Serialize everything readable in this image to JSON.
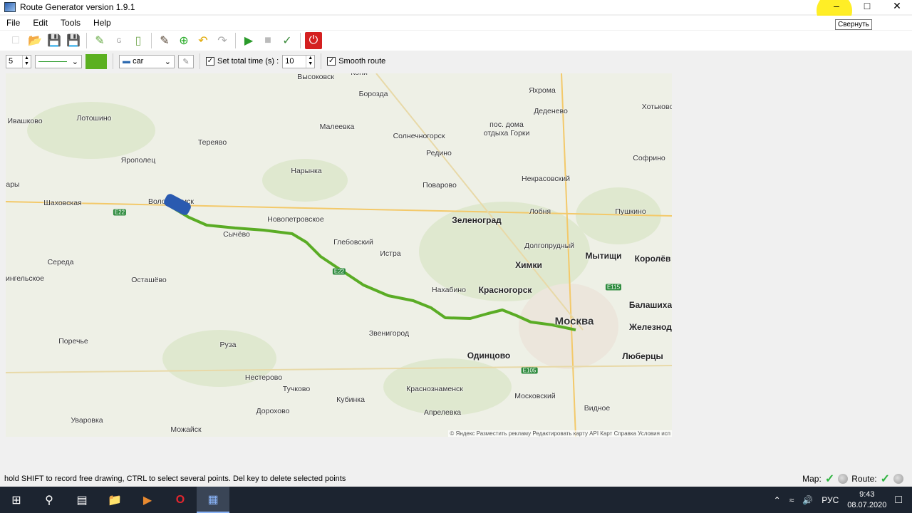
{
  "window": {
    "title": "Route Generator version 1.9.1",
    "minimize_tooltip": "Свернуть"
  },
  "menu": [
    "File",
    "Edit",
    "Tools",
    "Help"
  ],
  "toolbar": [
    "new-file",
    "open-folder",
    "save",
    "save-as",
    "edit-route",
    "import-google",
    "gps-device",
    "draw-brush",
    "add-point",
    "undo",
    "redo",
    "play",
    "stop",
    "export-route",
    "exit-power"
  ],
  "options": {
    "line_width": "5",
    "line_color": "#5bb020",
    "vehicle": "car",
    "set_total_time_label": "Set total time (s) :",
    "set_total_time_checked": true,
    "total_time": "10",
    "smooth_route_label": "Smooth route",
    "smooth_route_checked": true
  },
  "map": {
    "route_color": "#5aac25",
    "labels": [
      "Высоковск",
      "Борозда",
      "Яхрома",
      "Деденево",
      "Хотьково",
      "Ивашково",
      "Лотошино",
      "Малеевка",
      "Солнечногорск",
      "пос. дома",
      "отдыха Горки",
      "Тереяво",
      "Редино",
      "Софрино",
      "Ярополец",
      "Нарынка",
      "Некрасовский",
      "Поварово",
      "Шаховская",
      "Волоколамск",
      "Лобня",
      "Пушкино",
      "Зеленоград",
      "Новопетровское",
      "Сычёво",
      "Глебовский",
      "Долгопрудный",
      "Истра",
      "Мытищи",
      "Королёв",
      "Середа",
      "Химки",
      "ингельское",
      "Осташёво",
      "Нахабино",
      "Красногорск",
      "Балашиха",
      "Москва",
      "Железнод",
      "Звенигород",
      "Поречье",
      "Руза",
      "Одинцово",
      "Люберцы",
      "Нестерово",
      "Тучково",
      "Краснознаменск",
      "Московский",
      "Кубинка",
      "Дорохово",
      "Видное",
      "Апрелевка",
      "Уваровка",
      "Можайск",
      "ары",
      "Кони"
    ],
    "roads": [
      "E22",
      "E22",
      "E115",
      "E105"
    ],
    "copyright": "© Яндекс  Разместить рекламу  Редактировать карту  API Карт  Справка  Условия исп"
  },
  "status": {
    "hint": "hold SHIFT to record free drawing, CTRL to select several points. Del key to delete selected points",
    "map_label": "Map:",
    "route_label": "Route:"
  },
  "taskbar": {
    "lang": "РУС",
    "time": "9:43",
    "date": "08.07.2020"
  }
}
